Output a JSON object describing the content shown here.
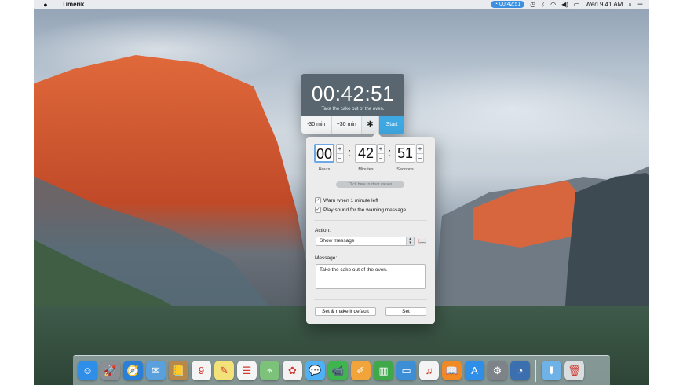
{
  "menubar": {
    "app_name": "Timerik",
    "timer_pill": "00:42:51",
    "clock": "Wed 9:41 AM",
    "icons": [
      "apple-icon",
      "timerik-icon",
      "time-machine-icon",
      "bluetooth-icon",
      "wifi-icon",
      "volume-icon",
      "battery-icon",
      "spotlight-icon",
      "notification-center-icon"
    ]
  },
  "timer": {
    "display": "00:42:51",
    "message": "Take the cake out of the oven.",
    "minus30_label": "-30 min",
    "plus30_label": "+30 min",
    "start_label": "Start"
  },
  "editor": {
    "hours": "00",
    "minutes": "42",
    "seconds": "51",
    "hours_label": "Hours",
    "minutes_label": "Minutes",
    "seconds_label": "Seconds",
    "clear_values": "Click here to clear values",
    "warn_label": "Warn when 1 minute left",
    "warn_checked": true,
    "sound_label": "Play sound for the warning message",
    "sound_checked": true,
    "action_label": "Action:",
    "action_value": "Show message",
    "message_label": "Message:",
    "message_value": "Take the cake out of the oven.",
    "set_default_label": "Set & make it default",
    "set_label": "Set"
  },
  "dock": {
    "apps": [
      {
        "name": "finder-icon",
        "color": "#2f8ee8",
        "glyph": "☺"
      },
      {
        "name": "launchpad-icon",
        "color": "#8a8f96",
        "glyph": "🚀"
      },
      {
        "name": "safari-icon",
        "color": "#2a7fd9",
        "glyph": "🧭"
      },
      {
        "name": "mail-icon",
        "color": "#5aa0dc",
        "glyph": "✉"
      },
      {
        "name": "contacts-icon",
        "color": "#b8884a",
        "glyph": "📒"
      },
      {
        "name": "calendar-icon",
        "color": "#f4f4f4",
        "glyph": "9"
      },
      {
        "name": "notes-icon",
        "color": "#f3e27a",
        "glyph": "✎"
      },
      {
        "name": "reminders-icon",
        "color": "#f5f5f5",
        "glyph": "☰"
      },
      {
        "name": "maps-icon",
        "color": "#7cc27a",
        "glyph": "⌖"
      },
      {
        "name": "photos-icon",
        "color": "#f2f2f2",
        "glyph": "✿"
      },
      {
        "name": "messages-icon",
        "color": "#4fb1f5",
        "glyph": "💬"
      },
      {
        "name": "facetime-icon",
        "color": "#3fb54f",
        "glyph": "📹"
      },
      {
        "name": "pages-icon",
        "color": "#f0a43a",
        "glyph": "✐"
      },
      {
        "name": "numbers-icon",
        "color": "#3fa84a",
        "glyph": "▥"
      },
      {
        "name": "keynote-icon",
        "color": "#3c8fd6",
        "glyph": "▭"
      },
      {
        "name": "itunes-icon",
        "color": "#f4f4f4",
        "glyph": "♫"
      },
      {
        "name": "ibooks-icon",
        "color": "#f08a25",
        "glyph": "📖"
      },
      {
        "name": "app-store-icon",
        "color": "#2f8ee8",
        "glyph": "A"
      },
      {
        "name": "system-preferences-icon",
        "color": "#7d8388",
        "glyph": "⚙"
      },
      {
        "name": "timerik-dock-icon",
        "color": "#3b6fb0",
        "glyph": "◔"
      }
    ],
    "trailing": [
      {
        "name": "downloads-folder-icon",
        "color": "#6fb2e8",
        "glyph": "⬇"
      },
      {
        "name": "trash-icon",
        "color": "#d9dde0",
        "glyph": "🗑"
      }
    ]
  }
}
